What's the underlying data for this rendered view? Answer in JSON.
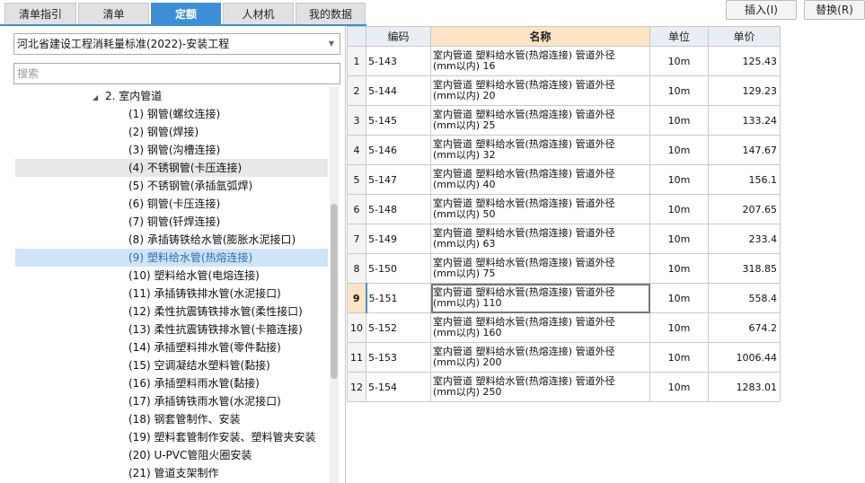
{
  "tabs": [
    {
      "label": "清单指引",
      "active": false
    },
    {
      "label": "清单",
      "active": false
    },
    {
      "label": "定额",
      "active": true
    },
    {
      "label": "人材机",
      "active": false
    },
    {
      "label": "我的数据",
      "active": false
    }
  ],
  "toolbar": {
    "insert_label": "插入(I)",
    "replace_label": "替换(R)"
  },
  "library": {
    "selected": "河北省建设工程消耗量标准(2022)-安装工程"
  },
  "search": {
    "placeholder": "搜索"
  },
  "tree": {
    "parent": "2. 室内管道",
    "items": [
      "(1) 钢管(螺纹连接)",
      "(2) 钢管(焊接)",
      "(3) 钢管(沟槽连接)",
      "(4) 不锈钢管(卡压连接)",
      "(5) 不锈钢管(承插氩弧焊)",
      "(6) 铜管(卡压连接)",
      "(7) 铜管(钎焊连接)",
      "(8) 承插铸铁给水管(膨胀水泥接口)",
      "(9) 塑料给水管(热熔连接)",
      "(10) 塑料给水管(电熔连接)",
      "(11) 承插铸铁排水管(水泥接口)",
      "(12) 柔性抗震铸铁排水管(柔性接口)",
      "(13) 柔性抗震铸铁排水管(卡箍连接)",
      "(14) 承插塑料排水管(零件黏接)",
      "(15) 空调凝结水塑料管(黏接)",
      "(16) 承插塑料雨水管(黏接)",
      "(17) 承插铸铁雨水管(水泥接口)",
      "(18) 钢套管制作、安装",
      "(19) 塑料套管制作安装、塑料管夹安装",
      "(20) U-PVC管阻火圈安装",
      "(21) 管道支架制作"
    ]
  },
  "table": {
    "headers": {
      "code": "编码",
      "name": "名称",
      "unit": "单位",
      "price": "单价"
    },
    "rows": [
      {
        "index": "1",
        "code": "5-143",
        "name_line1": "室内管道 塑料给水管(热熔连接) 管道外径",
        "name_line2": "(mm以内) 16",
        "unit": "10m",
        "price": "125.43"
      },
      {
        "index": "2",
        "code": "5-144",
        "name_line1": "室内管道 塑料给水管(热熔连接) 管道外径",
        "name_line2": "(mm以内) 20",
        "unit": "10m",
        "price": "129.23"
      },
      {
        "index": "3",
        "code": "5-145",
        "name_line1": "室内管道 塑料给水管(热熔连接) 管道外径",
        "name_line2": "(mm以内) 25",
        "unit": "10m",
        "price": "133.24"
      },
      {
        "index": "4",
        "code": "5-146",
        "name_line1": "室内管道 塑料给水管(热熔连接) 管道外径",
        "name_line2": "(mm以内) 32",
        "unit": "10m",
        "price": "147.67"
      },
      {
        "index": "5",
        "code": "5-147",
        "name_line1": "室内管道 塑料给水管(热熔连接) 管道外径",
        "name_line2": "(mm以内) 40",
        "unit": "10m",
        "price": "156.1"
      },
      {
        "index": "6",
        "code": "5-148",
        "name_line1": "室内管道 塑料给水管(热熔连接) 管道外径",
        "name_line2": "(mm以内) 50",
        "unit": "10m",
        "price": "207.65"
      },
      {
        "index": "7",
        "code": "5-149",
        "name_line1": "室内管道 塑料给水管(热熔连接) 管道外径",
        "name_line2": "(mm以内) 63",
        "unit": "10m",
        "price": "233.4"
      },
      {
        "index": "8",
        "code": "5-150",
        "name_line1": "室内管道 塑料给水管(热熔连接) 管道外径",
        "name_line2": "(mm以内) 75",
        "unit": "10m",
        "price": "318.85"
      },
      {
        "index": "9",
        "code": "5-151",
        "name_line1": "室内管道 塑料给水管(热熔连接) 管道外径",
        "name_line2": "(mm以内) 110",
        "unit": "10m",
        "price": "558.4"
      },
      {
        "index": "10",
        "code": "5-152",
        "name_line1": "室内管道 塑料给水管(热熔连接) 管道外径",
        "name_line2": "(mm以内) 160",
        "unit": "10m",
        "price": "674.2"
      },
      {
        "index": "11",
        "code": "5-153",
        "name_line1": "室内管道 塑料给水管(热熔连接) 管道外径",
        "name_line2": "(mm以内) 200",
        "unit": "10m",
        "price": "1006.44"
      },
      {
        "index": "12",
        "code": "5-154",
        "name_line1": "室内管道 塑料给水管(热熔连接) 管道外径",
        "name_line2": "(mm以内) 250",
        "unit": "10m",
        "price": "1283.01"
      }
    ]
  }
}
